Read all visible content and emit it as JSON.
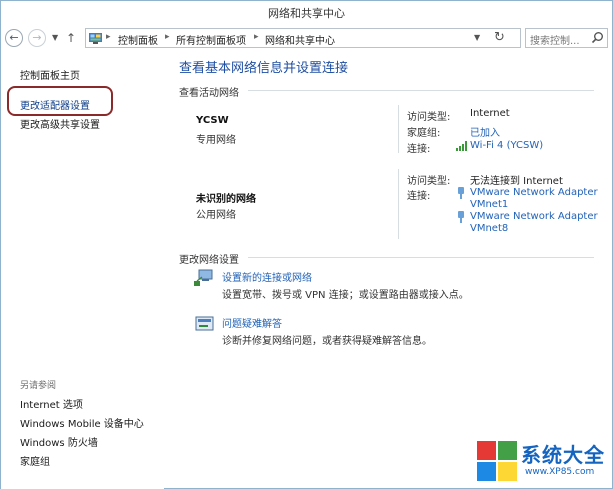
{
  "window": {
    "title": "网络和共享中心"
  },
  "nav": {
    "breadcrumbs": [
      "控制面板",
      "所有控制面板项",
      "网络和共享中心"
    ],
    "search_placeholder": "搜索控制...",
    "icons": [
      "back-arrow-icon",
      "forward-arrow-icon",
      "up-arrow-icon",
      "control-panel-icon",
      "refresh-icon",
      "search-icon"
    ]
  },
  "sidebar": {
    "home": "控制面板主页",
    "items": [
      "更改适配器设置",
      "更改高级共享设置"
    ],
    "see_also_heading": "另请参阅",
    "see_also": [
      "Internet 选项",
      "Windows Mobile 设备中心",
      "Windows 防火墙",
      "家庭组"
    ]
  },
  "main": {
    "heading": "查看基本网络信息并设置连接",
    "active_networks_label": "查看活动网络",
    "networks": [
      {
        "name": "YCSW",
        "type": "专用网络",
        "access_type_label": "访问类型:",
        "access_type": "Internet",
        "homegroup_label": "家庭组:",
        "homegroup": "已加入",
        "connections_label": "连接:",
        "connection": "Wi-Fi 4 (YCSW)"
      },
      {
        "name": "未识别的网络",
        "type": "公用网络",
        "access_type_label": "访问类型:",
        "access_type": "无法连接到 Internet",
        "connections_label": "连接:",
        "connections": [
          {
            "line1": "VMware Network Adapter",
            "line2": "VMnet1"
          },
          {
            "line1": "VMware Network Adapter",
            "line2": "VMnet8"
          }
        ]
      }
    ],
    "change_settings_label": "更改网络设置",
    "tasks": [
      {
        "link": "设置新的连接或网络",
        "desc": "设置宽带、拨号或 VPN 连接；或设置路由器或接入点。"
      },
      {
        "link": "问题疑难解答",
        "desc": "诊断并修复网络问题，或者获得疑难解答信息。"
      }
    ]
  },
  "watermark": {
    "brand": "系统大全",
    "url": "www.XP85.com"
  },
  "colors": {
    "heading_blue": "#1f4fa3",
    "link_blue": "#2263b8",
    "highlight_box": "#8b2a2a"
  }
}
